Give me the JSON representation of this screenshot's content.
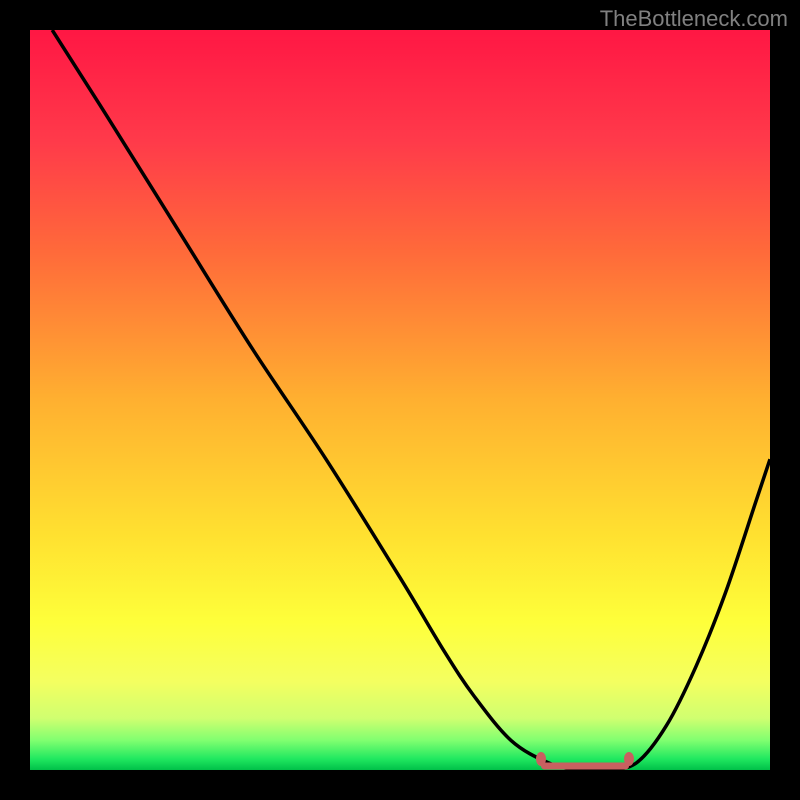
{
  "watermark": "TheBottleneck.com",
  "chart_data": {
    "type": "line",
    "title": "",
    "xlabel": "",
    "ylabel": "",
    "xlim": [
      0,
      100
    ],
    "ylim": [
      0,
      100
    ],
    "series": [
      {
        "name": "bottleneck-curve",
        "x": [
          3,
          10,
          20,
          30,
          40,
          50,
          56,
          60,
          65,
          70,
          74,
          78,
          82,
          86,
          90,
          94,
          98,
          100
        ],
        "y": [
          100,
          89,
          73,
          57,
          42,
          26,
          16,
          10,
          4,
          1,
          0,
          0,
          1,
          6,
          14,
          24,
          36,
          42
        ]
      }
    ],
    "flat_region": {
      "x_start": 69,
      "x_end": 81,
      "y": 0.5
    },
    "markers": [
      {
        "x": 69,
        "y": 1.5
      },
      {
        "x": 81,
        "y": 1.5
      }
    ],
    "gradient_stops": [
      {
        "offset": 0,
        "color": "#ff1744"
      },
      {
        "offset": 15,
        "color": "#ff3a4a"
      },
      {
        "offset": 30,
        "color": "#ff6a3a"
      },
      {
        "offset": 50,
        "color": "#ffb030"
      },
      {
        "offset": 68,
        "color": "#ffe030"
      },
      {
        "offset": 80,
        "color": "#feff3a"
      },
      {
        "offset": 88,
        "color": "#f4ff60"
      },
      {
        "offset": 93,
        "color": "#d0ff70"
      },
      {
        "offset": 96,
        "color": "#80ff70"
      },
      {
        "offset": 98.5,
        "color": "#20e860"
      },
      {
        "offset": 100,
        "color": "#00c048"
      }
    ]
  }
}
